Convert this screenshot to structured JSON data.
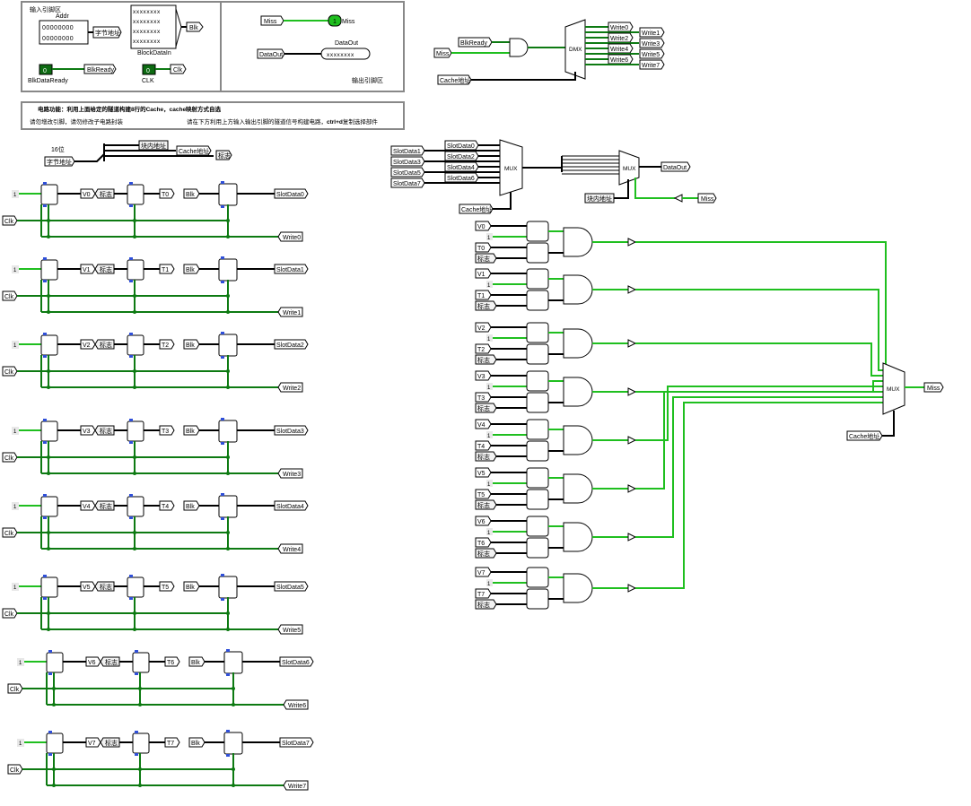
{
  "input_area": {
    "title": "输入引脚区",
    "addr_label": "Addr",
    "addr_bits_row1": "00000000",
    "addr_bits_row2": "00000000",
    "byte_addr": "字节地址",
    "blockdata_bits": "xxxxxxxx",
    "blk": "Blk",
    "blockdatain": "BlockDataIn",
    "blkready_value": "0",
    "blkready_tunnel": "BlkReady",
    "blkdataready_label": "BlkDataReady",
    "clk_value": "0",
    "clk_tunnel": "Clk",
    "clk_label": "CLK"
  },
  "output_area": {
    "miss_tunnel": "Miss",
    "miss_value": "1",
    "miss_label": "Miss",
    "dataout_tunnel": "DataOut",
    "dataout_label": "DataOut",
    "dataout_bits": "xxxxxxxx",
    "title": "输出引脚区"
  },
  "description": {
    "function": "电路功能：利用上面给定的隧道构建8行的Cache，cache映射方式自选",
    "note_left": "请勿增改引脚，请勿修改子电路封装",
    "note_right_pre": "请在下方利用上方输入输出引脚的隧道信号构建电路，",
    "note_right_key": "ctrl+d",
    "note_right_post": "复制选择部件"
  },
  "splitter": {
    "bits_label": "16位",
    "byte_addr": "字节地址",
    "block_offset": "块内地址",
    "cache_addr": "Cache地址",
    "tag": "标志"
  },
  "rows": [
    {
      "index": "1",
      "v": "V0",
      "tag": "标志",
      "t": "T0",
      "blk": "Blk",
      "slot": "SlotData0",
      "clk": "Clk",
      "write": "Write0"
    },
    {
      "index": "1",
      "v": "V1",
      "tag": "标志",
      "t": "T1",
      "blk": "Blk",
      "slot": "SlotData1",
      "clk": "Clk",
      "write": "Write1"
    },
    {
      "index": "1",
      "v": "V2",
      "tag": "标志",
      "t": "T2",
      "blk": "Blk",
      "slot": "SlotData2",
      "clk": "Clk",
      "write": "Write2"
    },
    {
      "index": "1",
      "v": "V3",
      "tag": "标志",
      "t": "T3",
      "blk": "Blk",
      "slot": "SlotData3",
      "clk": "Clk",
      "write": "Write3"
    },
    {
      "index": "1",
      "v": "V4",
      "tag": "标志",
      "t": "T4",
      "blk": "Blk",
      "slot": "SlotData4",
      "clk": "Clk",
      "write": "Write4"
    },
    {
      "index": "1",
      "v": "V5",
      "tag": "标志",
      "t": "T5",
      "blk": "Blk",
      "slot": "SlotData5",
      "clk": "Clk",
      "write": "Write5"
    },
    {
      "index": "1",
      "v": "V6",
      "tag": "标志",
      "t": "T6",
      "blk": "Blk",
      "slot": "SlotData6",
      "clk": "Clk",
      "write": "Write6"
    },
    {
      "index": "1",
      "v": "V7",
      "tag": "标志",
      "t": "T7",
      "blk": "Blk",
      "slot": "SlotData7",
      "clk": "Clk",
      "write": "Write7"
    }
  ],
  "write_logic": {
    "blkready": "BlkReady",
    "miss": "Miss",
    "dmx": "DMX",
    "cache_addr": "Cache地址",
    "writes": [
      "Write0",
      "Write1",
      "Write2",
      "Write3",
      "Write4",
      "Write5",
      "Write6",
      "Write7"
    ]
  },
  "read_logic": {
    "slots_left": [
      "SlotData1",
      "SlotData3",
      "SlotData5",
      "SlotData7"
    ],
    "slots_right": [
      "SlotData0",
      "SlotData2",
      "SlotData4",
      "SlotData6"
    ],
    "mux1": "MUX",
    "mux2": "MUX",
    "dataout": "DataOut",
    "cache_addr": "Cache地址",
    "block_offset": "块内地址",
    "miss": "Miss"
  },
  "hit_logic": {
    "one": "1",
    "tag": "标志",
    "v_labels": [
      "V0",
      "V1",
      "V2",
      "V3",
      "V4",
      "V5",
      "V6",
      "V7"
    ],
    "t_labels": [
      "T0",
      "T1",
      "T2",
      "T3",
      "T4",
      "T5",
      "T6",
      "T7"
    ],
    "mux": "MUX",
    "miss": "Miss",
    "cache_addr": "Cache地址"
  }
}
